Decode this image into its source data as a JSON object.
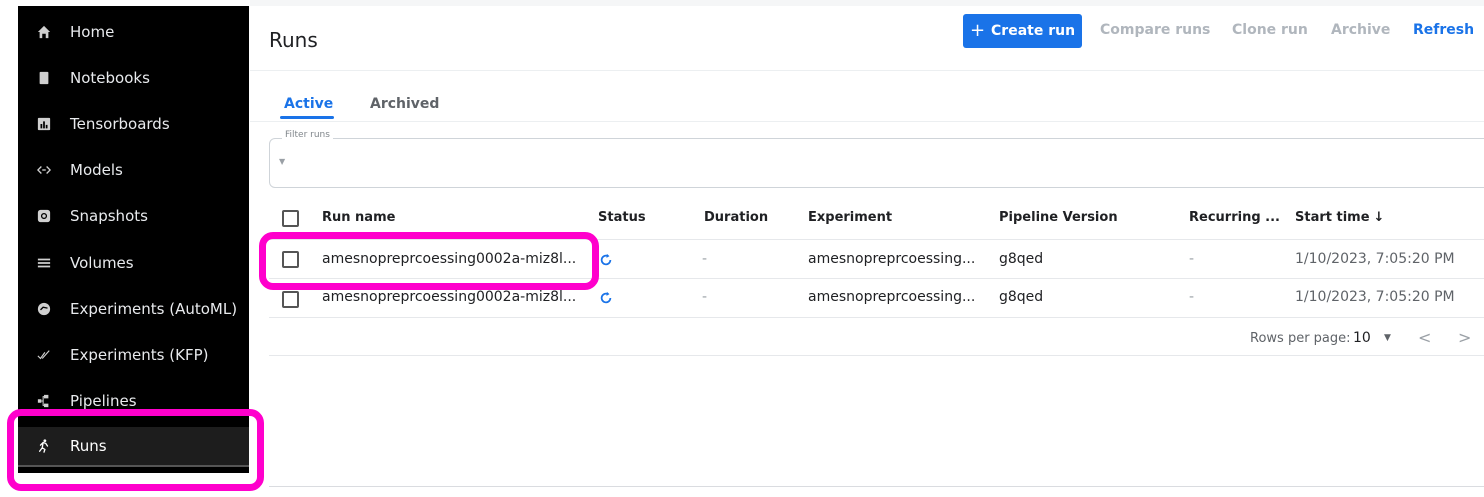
{
  "sidebar": {
    "items": [
      {
        "label": "Home",
        "icon": "home-icon"
      },
      {
        "label": "Notebooks",
        "icon": "notebook-icon"
      },
      {
        "label": "Tensorboards",
        "icon": "tensorboard-icon"
      },
      {
        "label": "Models",
        "icon": "code-arrows-icon"
      },
      {
        "label": "Snapshots",
        "icon": "snapshot-icon"
      },
      {
        "label": "Volumes",
        "icon": "storage-icon"
      },
      {
        "label": "Experiments (AutoML)",
        "icon": "automl-icon"
      },
      {
        "label": "Experiments (KFP)",
        "icon": "done-all-icon"
      },
      {
        "label": "Pipelines",
        "icon": "pipeline-icon"
      },
      {
        "label": "Runs",
        "icon": "run-icon",
        "active": true
      }
    ]
  },
  "header": {
    "title": "Runs",
    "create_plus": "+",
    "create_label": "Create run",
    "compare_label": "Compare runs",
    "clone_label": "Clone run",
    "archive_label": "Archive",
    "refresh_label": "Refresh"
  },
  "tabs": [
    {
      "label": "Active",
      "active": true
    },
    {
      "label": "Archived",
      "active": false
    }
  ],
  "filter": {
    "label": "Filter runs",
    "arrow": "▼"
  },
  "table": {
    "columns": [
      "Run name",
      "Status",
      "Duration",
      "Experiment",
      "Pipeline Version",
      "Recurring ...",
      "Start time"
    ],
    "sort_indicator": "↓",
    "rows": [
      {
        "run_name": "amesnopreprcoessing0002a-miz8l...",
        "status": "running",
        "duration": "-",
        "experiment": "amesnopreprcoessing...",
        "pipeline_version": "g8qed",
        "recurring": "-",
        "start_time": "1/10/2023, 7:05:20 PM"
      },
      {
        "run_name": "amesnopreprcoessing0002a-miz8l...",
        "status": "running",
        "duration": "-",
        "experiment": "amesnopreprcoessing...",
        "pipeline_version": "g8qed",
        "recurring": "-",
        "start_time": "1/10/2023, 7:05:20 PM"
      }
    ]
  },
  "pagination": {
    "rows_per_page_label": "Rows per page:",
    "rows_per_page_value": "10",
    "caret": "▼",
    "prev": "<",
    "next": ">"
  },
  "colors": {
    "accent": "#1a73e8",
    "highlight": "#ff00cc",
    "sidebar_bg": "#000000"
  }
}
